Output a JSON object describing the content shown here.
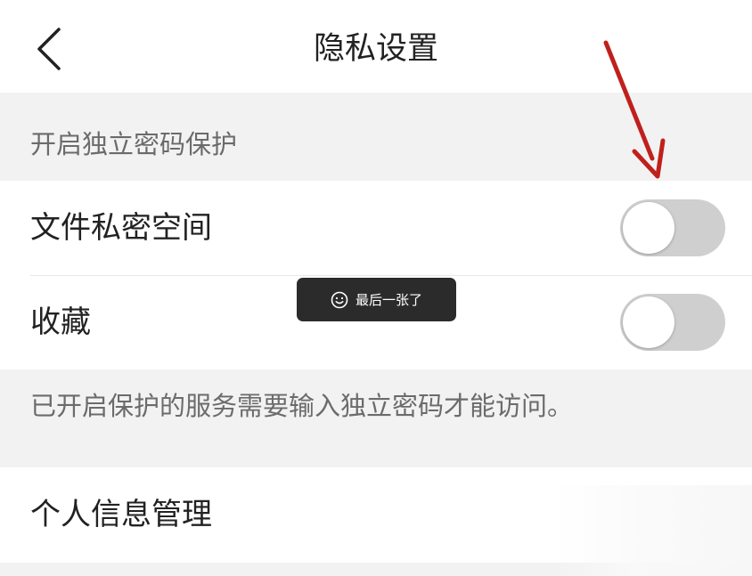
{
  "header": {
    "title": "隐私设置",
    "back_icon": "chevron-left-icon"
  },
  "section": {
    "title": "开启独立密码保护"
  },
  "items": [
    {
      "label": "文件私密空间",
      "enabled": false
    },
    {
      "label": "收藏",
      "enabled": false
    }
  ],
  "footnote": "已开启保护的服务需要输入独立密码才能访问。",
  "info_item": {
    "label": "个人信息管理"
  },
  "toast": {
    "text": "最后一张了",
    "icon": "smile-icon"
  },
  "annotation": {
    "type": "red-arrow",
    "color": "#c0201c"
  },
  "colors": {
    "background": "#f2f2f2",
    "card": "#ffffff",
    "toggle_off": "#cfcfcf",
    "toast_bg": "#2b2b2b"
  }
}
